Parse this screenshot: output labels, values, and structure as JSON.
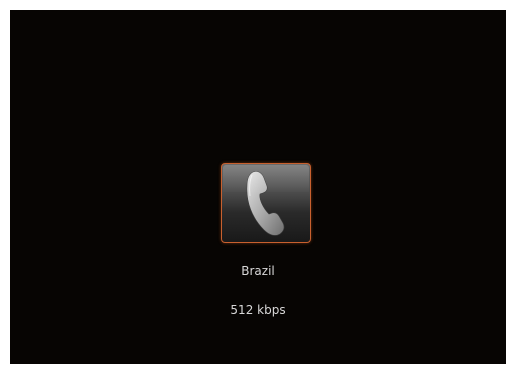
{
  "call": {
    "contact_name": "Brazil",
    "bitrate": "512 kbps",
    "button_icon": "phone-handset-icon"
  },
  "colors": {
    "background": "#070503",
    "accent_border": "#c8602e",
    "text": "#d8d8d8"
  }
}
